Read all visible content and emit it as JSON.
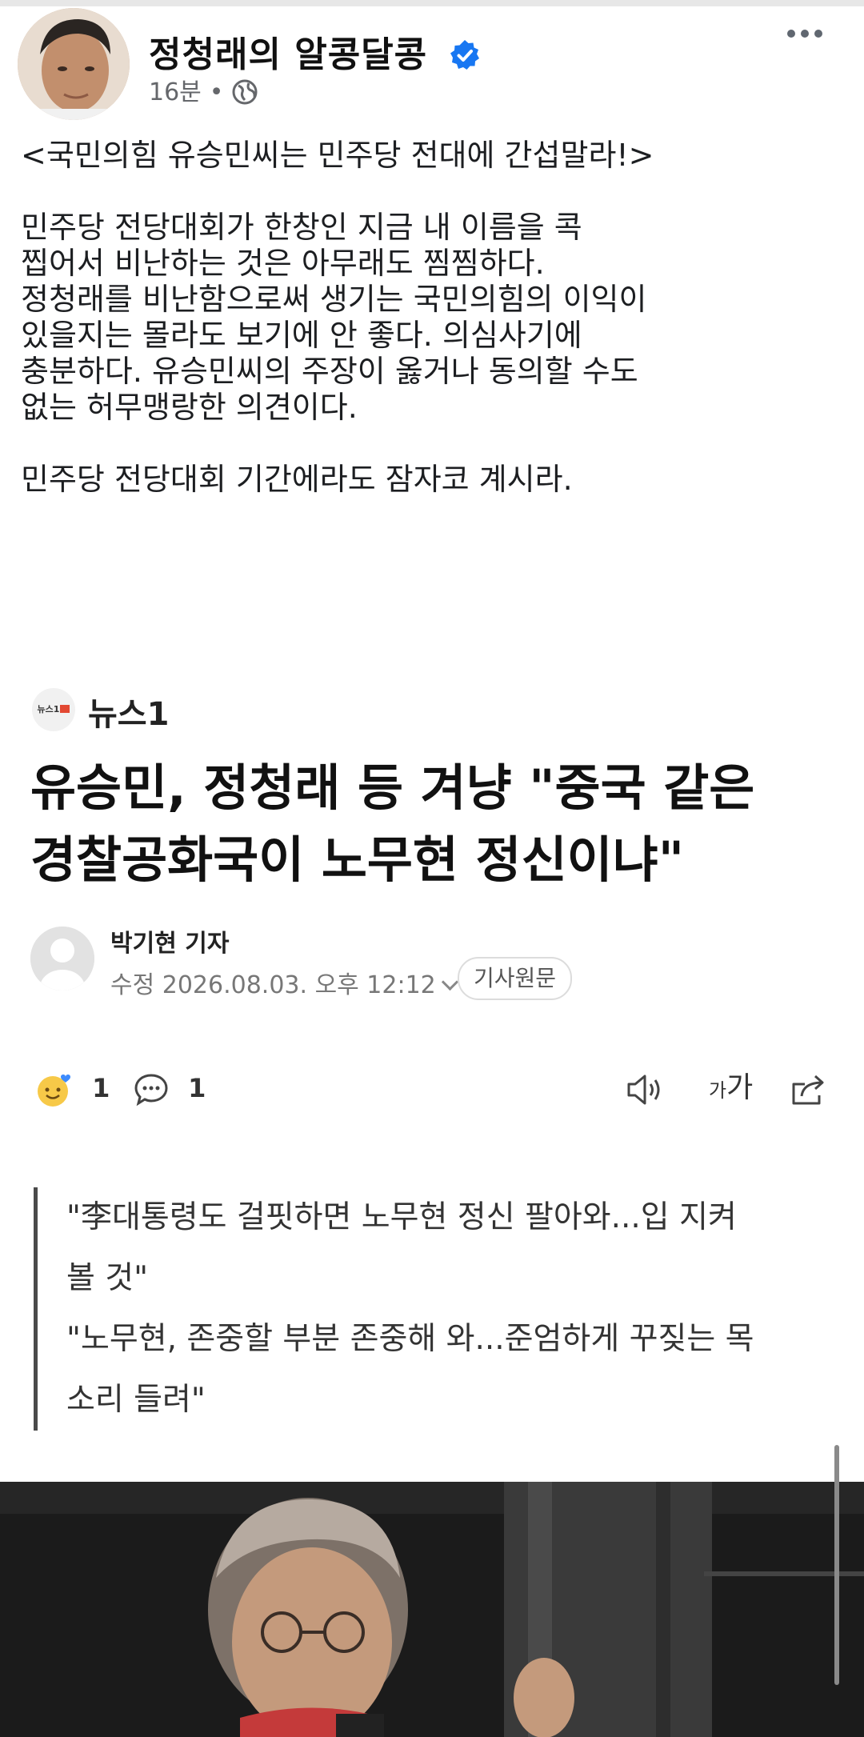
{
  "post": {
    "page_name": "정청래의 알콩달콩",
    "time": "16분",
    "separator": "•",
    "text_lines": [
      "<국민의힘 유승민씨는 민주당 전대에 간섭말라!>",
      "",
      "민주당 전당대회가 한창인 지금 내 이름을 콕",
      "찝어서  비난하는 것은 아무래도 찜찜하다.",
      "정청래를 비난함으로써 생기는 국민의힘의 이익이",
      "있을지는 몰라도 보기에 안 좋다. 의심사기에",
      "충분하다. 유승민씨의 주장이 옳거나  동의할 수도",
      "없는 허무맹랑한 의견이다.",
      "",
      "민주당 전당대회 기간에라도 잠자코 계시라."
    ]
  },
  "article": {
    "source_logo_text": "뉴스1",
    "source_name": "뉴스1",
    "headline_lines": [
      "유승민, 정청래 등 겨냥 \"중국 같은",
      "경찰공화국이 노무현 정신이냐\""
    ],
    "author": "박기현 기자",
    "edited": "수정 2026.08.03. 오후 12:12",
    "original_button": "기사원문",
    "reactions_count": "1",
    "comments_count": "1",
    "font_size_label_small": "가",
    "font_size_label_large": "가",
    "quote_lines": [
      "\"李대통령도 걸핏하면 노무현 정신 팔아와...입 지켜",
      "볼 것\"",
      "\"노무현, 존중할 부분 존중해 와...준엄하게 꾸짖는 목",
      "소리 들려\""
    ]
  },
  "colors": {
    "verified": "#1877f2",
    "text_primary": "#1c1e21",
    "text_secondary": "#65676b",
    "news1_red": "#e24832"
  },
  "icons": {
    "verified": "verified-badge-icon",
    "audience": "globe-icon",
    "more": "more-options-icon",
    "reaction": "smile-heart-icon",
    "comment": "comment-bubble-icon",
    "tts": "speaker-icon",
    "font": "font-size-icon",
    "share": "share-icon"
  }
}
